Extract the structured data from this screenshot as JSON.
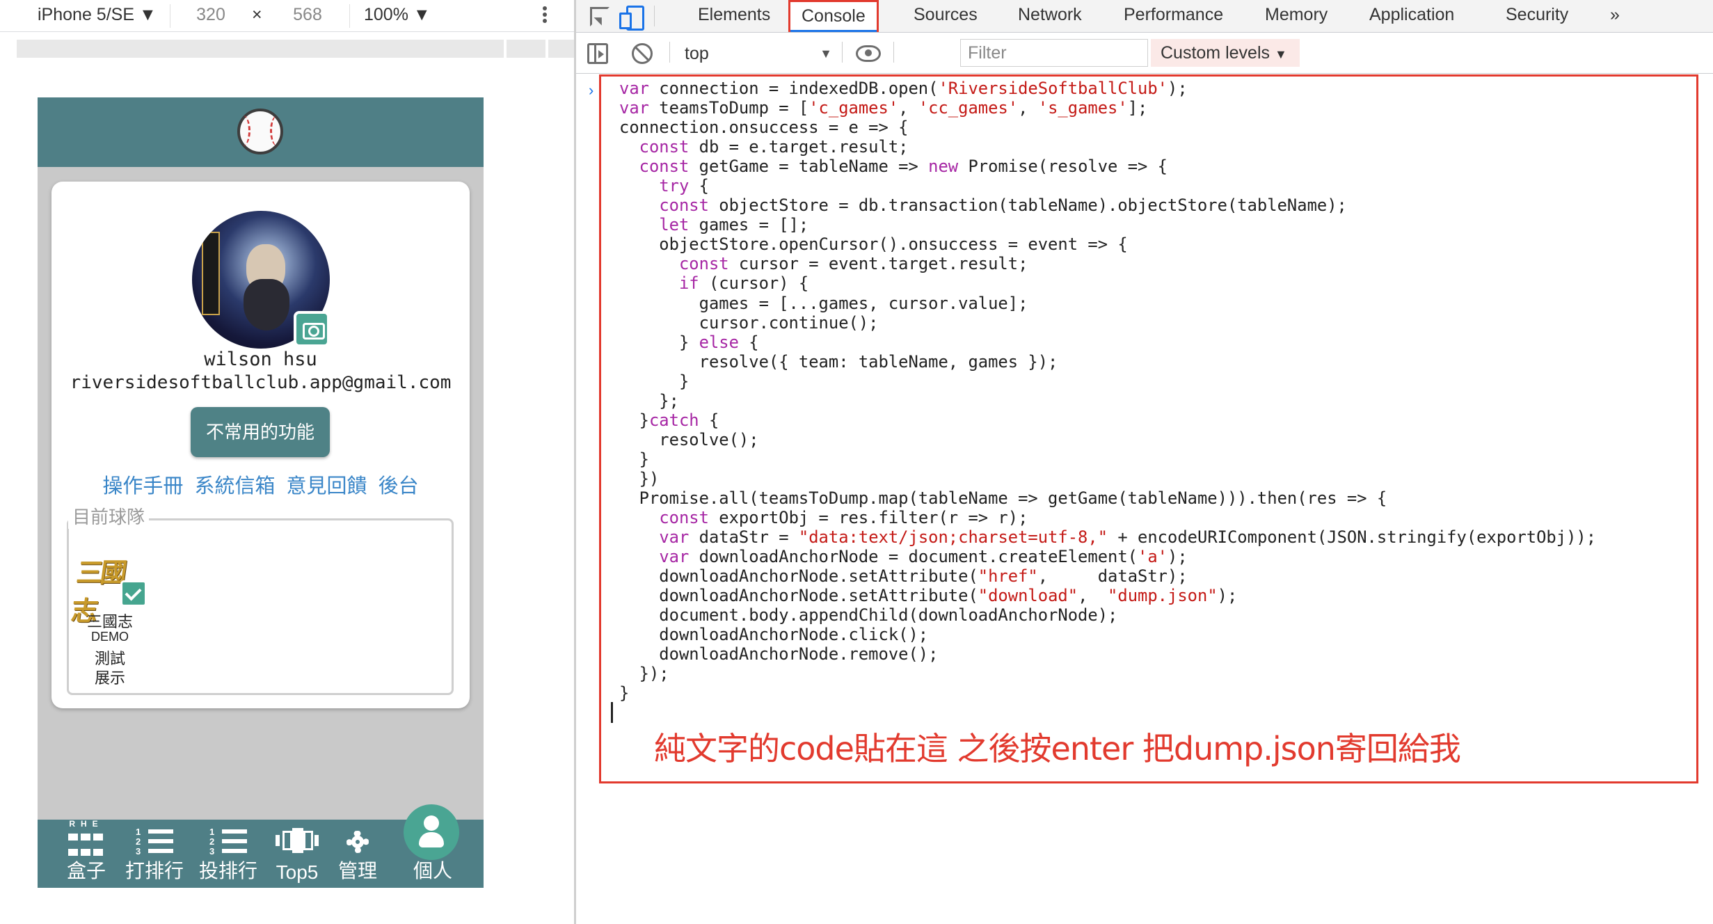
{
  "device_toolbar": {
    "device": "iPhone 5/SE",
    "width": "320",
    "separator": "×",
    "height": "568",
    "zoom": "100%"
  },
  "app": {
    "user_name": "wilson hsu",
    "user_email": "riversidesoftballclub.app@gmail.com",
    "rare_button": "不常用的功能",
    "links": [
      "操作手冊",
      "系統信箱",
      "意見回饋",
      "後台"
    ],
    "team_legend": "目前球隊",
    "team": {
      "logo_text": "三國志",
      "name": "三國志",
      "line2": "DEMO",
      "line3": "測試",
      "line4": "展示"
    },
    "nav": {
      "box": {
        "label": "盒子",
        "rhe": "RHE"
      },
      "bat": {
        "label": "打排行"
      },
      "pitch": {
        "label": "投排行"
      },
      "top5": {
        "label": "Top5"
      },
      "manage": {
        "label": "管理"
      },
      "me": {
        "label": "個人"
      }
    },
    "colors": {
      "header": "#4f7f86",
      "accent": "#4aa593",
      "link": "#3a86c8"
    }
  },
  "devtools": {
    "tabs": [
      "Elements",
      "Console",
      "Sources",
      "Network",
      "Performance",
      "Memory",
      "Application",
      "Security",
      "»"
    ],
    "active_tab": "Console",
    "context": "top",
    "filter_placeholder": "Filter",
    "levels": "Custom levels",
    "annotation": "純文字的code貼在這 之後按enter 把dump.json寄回給我",
    "code_lines": [
      "var connection = indexedDB.open('RiversideSoftballClub');",
      "var teamsToDump = ['c_games', 'cc_games', 's_games'];",
      "connection.onsuccess = e => {",
      "  const db = e.target.result;",
      "  const getGame = tableName => new Promise(resolve => {",
      "    try {",
      "    const objectStore = db.transaction(tableName).objectStore(tableName);",
      "    let games = [];",
      "    objectStore.openCursor().onsuccess = event => {",
      "      const cursor = event.target.result;",
      "      if (cursor) {",
      "        games = [...games, cursor.value];",
      "        cursor.continue();",
      "      } else {",
      "        resolve({ team: tableName, games });",
      "      }",
      "    };",
      "  }catch {",
      "    resolve();",
      "  }",
      "  })",
      "  Promise.all(teamsToDump.map(tableName => getGame(tableName))).then(res => {",
      "    const exportObj = res.filter(r => r);",
      "    var dataStr = \"data:text/json;charset=utf-8,\" + encodeURIComponent(JSON.stringify(exportObj));",
      "    var downloadAnchorNode = document.createElement('a');",
      "    downloadAnchorNode.setAttribute(\"href\",     dataStr);",
      "    downloadAnchorNode.setAttribute(\"download\",  \"dump.json\");",
      "    document.body.appendChild(downloadAnchorNode);",
      "    downloadAnchorNode.click();",
      "    downloadAnchorNode.remove();",
      "  });",
      "}"
    ],
    "colors": {
      "highlight": "#e23a2e",
      "active_tab_underline": "#1a73e8"
    }
  }
}
